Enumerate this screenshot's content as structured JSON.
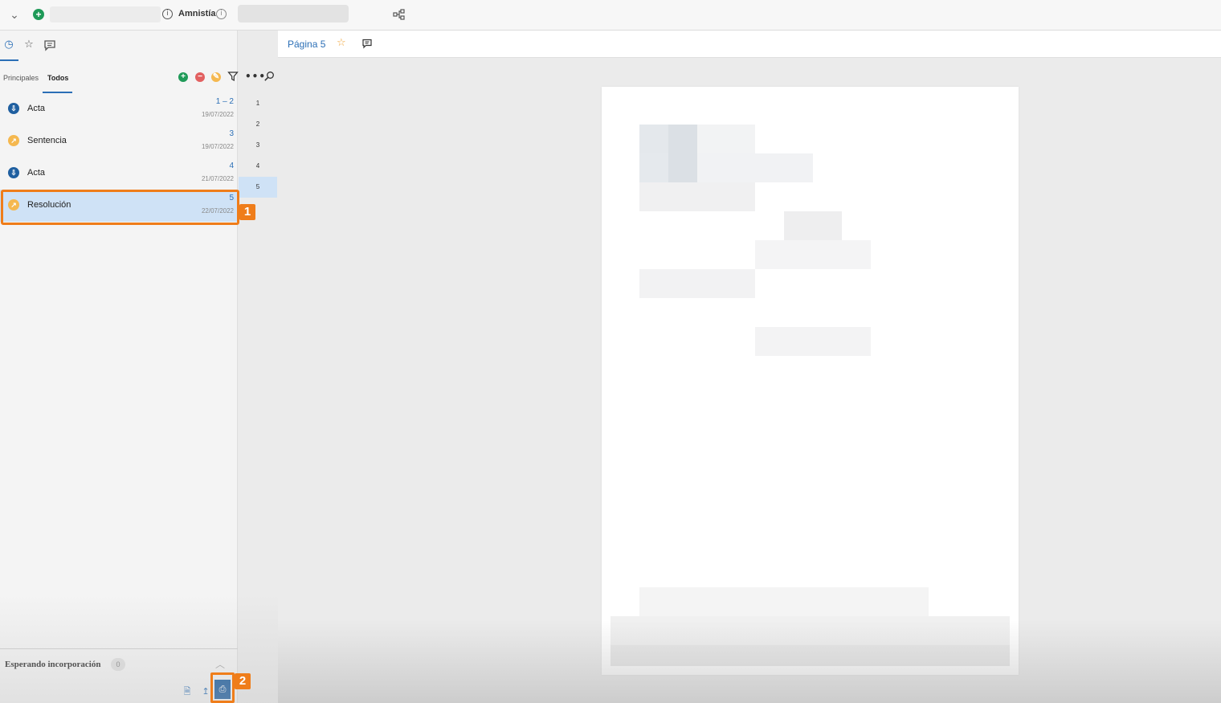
{
  "topbar": {
    "case_name": "Amnistía",
    "info_symbol": "i",
    "add_symbol": "+",
    "collapse_symbol": "⌄"
  },
  "sidebar": {
    "icons": [
      "clock-icon",
      "star-icon",
      "comment-icon"
    ],
    "tabs": {
      "principales": "Principales",
      "todos": "Todos"
    },
    "actions": {
      "add": "+",
      "remove": "−",
      "more": "•••"
    },
    "documents": [
      {
        "title": "Acta",
        "pages": "1 – 2",
        "date": "19/07/2022",
        "badge": "blue"
      },
      {
        "title": "Sentencia",
        "pages": "3",
        "date": "19/07/2022",
        "badge": "orange"
      },
      {
        "title": "Acta",
        "pages": "4",
        "date": "21/07/2022",
        "badge": "blue"
      },
      {
        "title": "Resolución",
        "pages": "5",
        "date": "22/07/2022",
        "badge": "orange",
        "selected": true
      }
    ],
    "page_numbers": [
      "1",
      "2",
      "3",
      "4",
      "5"
    ],
    "pending": {
      "label": "Esperando incorporación",
      "count": "0"
    }
  },
  "annotations": {
    "step1": "1",
    "step2": "2"
  },
  "viewer": {
    "page_label": "Página 5"
  },
  "colors": {
    "accent": "#2b6fb6",
    "highlight": "#ef7d1a",
    "selected_row": "#cfe2f6",
    "green": "#1f9a58",
    "red": "#e26060",
    "orange": "#f5b84f"
  }
}
